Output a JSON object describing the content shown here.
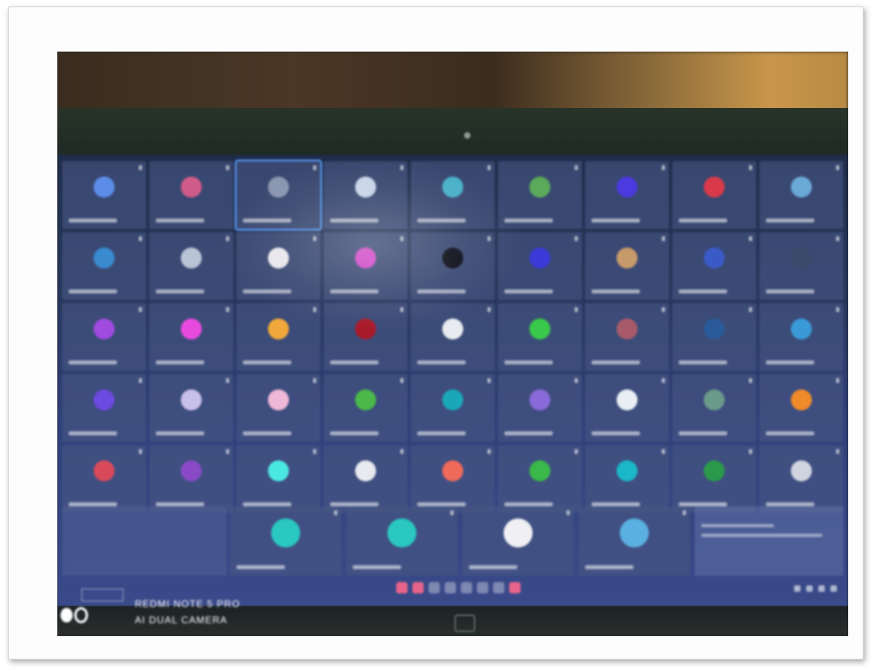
{
  "photo": {
    "subject": "",
    "grid_rows": [
      [
        {
          "avatar_color": "#5b8de8",
          "initial": "",
          "selected": false
        },
        {
          "avatar_color": "#d05a8a",
          "initial": "",
          "selected": false
        },
        {
          "avatar_color": "#8a96b0",
          "initial": "",
          "selected": true
        },
        {
          "avatar_color": "#c8d4e8",
          "initial": "",
          "selected": false
        },
        {
          "avatar_color": "#4ab0c8",
          "initial": "",
          "selected": false
        },
        {
          "avatar_color": "#5aaa5a",
          "initial": "",
          "selected": false
        },
        {
          "avatar_color": "#4a3ae0",
          "initial": "",
          "selected": false
        },
        {
          "avatar_color": "#d83a4a",
          "initial": "",
          "selected": false
        },
        {
          "avatar_color": "#6aa8d8",
          "initial": "",
          "selected": false
        }
      ],
      [
        {
          "avatar_color": "#3a8ad0",
          "initial": "",
          "selected": false
        },
        {
          "avatar_color": "#b8c4d4",
          "initial": "",
          "selected": false
        },
        {
          "avatar_color": "#e8e8ec",
          "initial": "",
          "selected": false
        },
        {
          "avatar_color": "#d048c8",
          "initial": "",
          "selected": false
        },
        {
          "avatar_color": "#0a0c18",
          "initial": "",
          "selected": false
        },
        {
          "avatar_color": "#3a3ad8",
          "initial": "",
          "selected": false
        },
        {
          "avatar_color": "#c89a6a",
          "initial": "",
          "selected": false
        },
        {
          "avatar_color": "#3a5ac8",
          "initial": "",
          "selected": false
        },
        {
          "avatar_color": "#3a4a6a",
          "initial": "",
          "selected": false
        }
      ],
      [
        {
          "avatar_color": "#a04ae0",
          "initial": "",
          "selected": false
        },
        {
          "avatar_color": "#e84ae0",
          "initial": "",
          "selected": false
        },
        {
          "avatar_color": "#f0a83a",
          "initial": "",
          "selected": false
        },
        {
          "avatar_color": "#a81a2a",
          "initial": "",
          "selected": false
        },
        {
          "avatar_color": "#e8ecf0",
          "initial": "",
          "selected": false
        },
        {
          "avatar_color": "#3ac84a",
          "initial": "",
          "selected": false
        },
        {
          "avatar_color": "#a85a6a",
          "initial": "",
          "selected": false
        },
        {
          "avatar_color": "#2a5a9a",
          "initial": "",
          "selected": false
        },
        {
          "avatar_color": "#3a9ad8",
          "initial": "",
          "selected": false
        }
      ],
      [
        {
          "avatar_color": "#6a4ae0",
          "initial": "",
          "selected": false
        },
        {
          "avatar_color": "#c8c0e8",
          "initial": "",
          "selected": false
        },
        {
          "avatar_color": "#f0b8d8",
          "initial": "",
          "selected": false
        },
        {
          "avatar_color": "#4ab84a",
          "initial": "",
          "selected": false
        },
        {
          "avatar_color": "#1aa8b8",
          "initial": "",
          "selected": false
        },
        {
          "avatar_color": "#8a6ad8",
          "initial": "",
          "selected": false
        },
        {
          "avatar_color": "#e8eef4",
          "initial": "",
          "selected": false
        },
        {
          "avatar_color": "#6a9a8a",
          "initial": "",
          "selected": false
        },
        {
          "avatar_color": "#f08a2a",
          "initial": "",
          "selected": false
        }
      ],
      [
        {
          "avatar_color": "#d84a5a",
          "initial": "",
          "selected": false
        },
        {
          "avatar_color": "#8a4ac8",
          "initial": "",
          "selected": false
        },
        {
          "avatar_color": "#4ae8e0",
          "initial": "",
          "selected": false
        },
        {
          "avatar_color": "#e8eaf0",
          "initial": "",
          "selected": false
        },
        {
          "avatar_color": "#f06a5a",
          "initial": "",
          "selected": false
        },
        {
          "avatar_color": "#3ab84a",
          "initial": "",
          "selected": false
        },
        {
          "avatar_color": "#1ab8c8",
          "initial": "",
          "selected": false
        },
        {
          "avatar_color": "#2a9a4a",
          "initial": "",
          "selected": false
        },
        {
          "avatar_color": "#d0d4e0",
          "initial": "",
          "selected": false
        }
      ]
    ],
    "bottom_row": [
      {
        "avatar_color": "#2ac8c0",
        "initial": ""
      },
      {
        "avatar_color": "#2ac8c0",
        "initial": ""
      },
      {
        "avatar_color": "#f0f0f4",
        "initial": ""
      },
      {
        "avatar_color": "#5ab0e0",
        "initial": ""
      }
    ],
    "pager_count": 8,
    "pager_active": [
      0,
      1,
      7
    ],
    "toolbar_icon_count": 4
  },
  "watermark": {
    "line1": "REDMI NOTE 5 PRO",
    "line2": "AI DUAL CAMERA"
  }
}
